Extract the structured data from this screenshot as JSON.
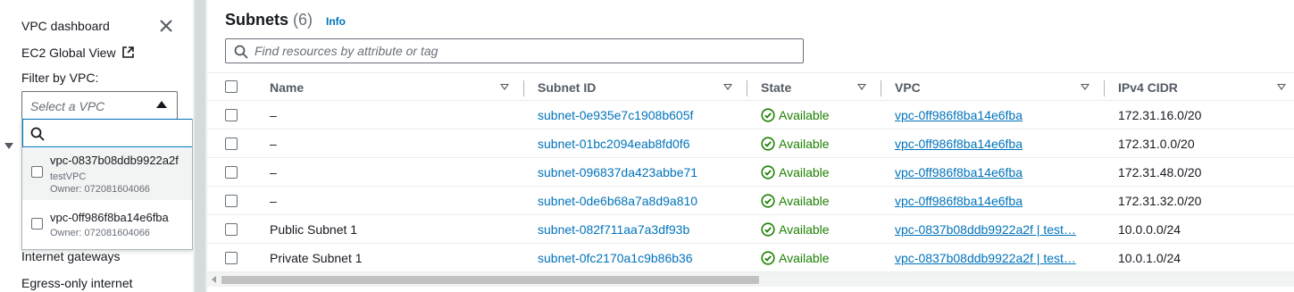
{
  "sidebar": {
    "vpc_dashboard": "VPC dashboard",
    "ec2_global_view": "EC2 Global View",
    "filter_label": "Filter by VPC:",
    "select_placeholder": "Select a VPC",
    "options": [
      {
        "id": "vpc-0837b08ddb9922a2f",
        "name": "testVPC",
        "owner": "Owner: 072081604066"
      },
      {
        "id": "vpc-0ff986f8ba14e6fba",
        "owner": "Owner: 072081604066"
      }
    ],
    "internet_gateways": "Internet gateways",
    "egress_only": "Egress-only internet"
  },
  "header": {
    "title": "Subnets",
    "count": "(6)",
    "info": "Info",
    "search_placeholder": "Find resources by attribute or tag"
  },
  "columns": {
    "name": "Name",
    "subnet_id": "Subnet ID",
    "state": "State",
    "vpc": "VPC",
    "cidr": "IPv4 CIDR"
  },
  "rows": [
    {
      "name": "–",
      "subnet_id": "subnet-0e935e7c1908b605f",
      "state": "Available",
      "vpc": "vpc-0ff986f8ba14e6fba",
      "cidr": "172.31.16.0/20"
    },
    {
      "name": "–",
      "subnet_id": "subnet-01bc2094eab8fd0f6",
      "state": "Available",
      "vpc": "vpc-0ff986f8ba14e6fba",
      "cidr": "172.31.0.0/20"
    },
    {
      "name": "–",
      "subnet_id": "subnet-096837da423abbe71",
      "state": "Available",
      "vpc": "vpc-0ff986f8ba14e6fba",
      "cidr": "172.31.48.0/20"
    },
    {
      "name": "–",
      "subnet_id": "subnet-0de6b68a7a8d9a810",
      "state": "Available",
      "vpc": "vpc-0ff986f8ba14e6fba",
      "cidr": "172.31.32.0/20"
    },
    {
      "name": "Public Subnet 1",
      "subnet_id": "subnet-082f711aa7a3df93b",
      "state": "Available",
      "vpc": "vpc-0837b08ddb9922a2f | test…",
      "cidr": "10.0.0.0/24"
    },
    {
      "name": "Private Subnet 1",
      "subnet_id": "subnet-0fc2170a1c9b86b36",
      "state": "Available",
      "vpc": "vpc-0837b08ddb9922a2f | test…",
      "cidr": "10.0.1.0/24"
    }
  ],
  "colors": {
    "link": "#0073bb",
    "available": "#1d8102",
    "text": "#16191f",
    "muted": "#687078"
  }
}
